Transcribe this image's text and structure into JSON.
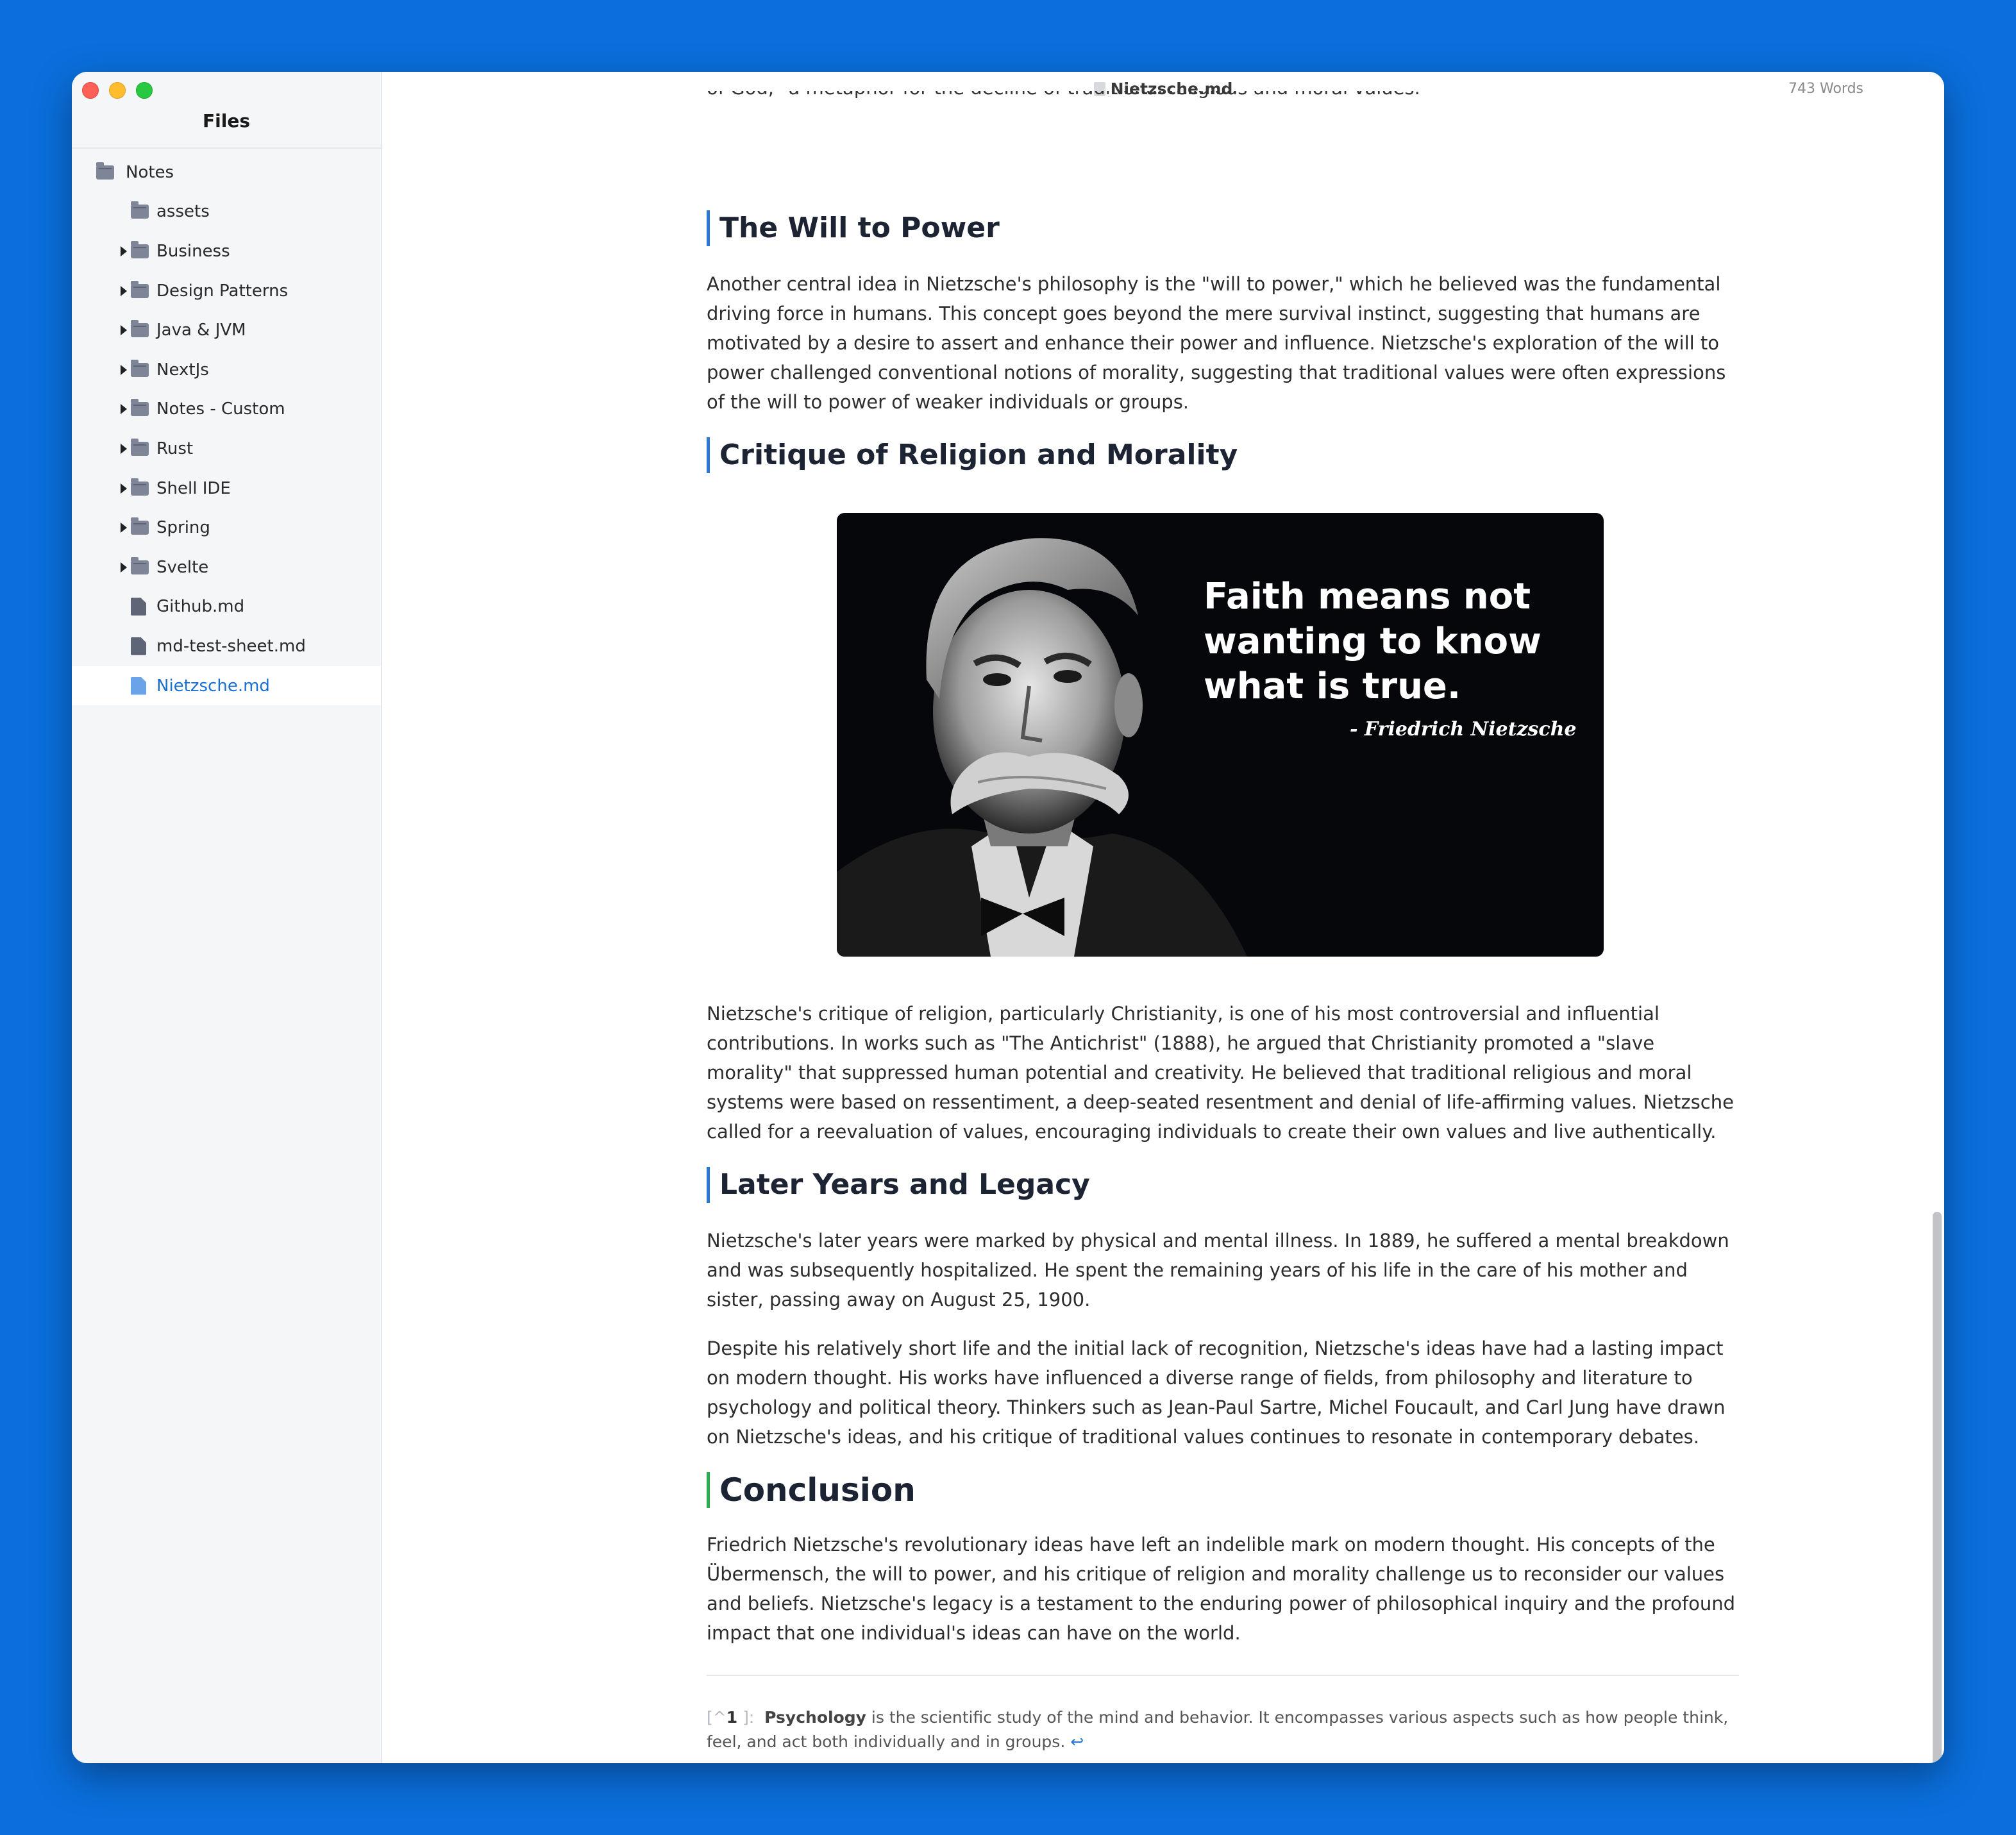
{
  "sidebar": {
    "title": "Files",
    "items": [
      {
        "label": "Notes",
        "type": "folder",
        "expandable": false,
        "depth": 0
      },
      {
        "label": "assets",
        "type": "folder",
        "expandable": false,
        "depth": 1
      },
      {
        "label": "Business",
        "type": "folder",
        "expandable": true,
        "depth": 1
      },
      {
        "label": "Design Patterns",
        "type": "folder",
        "expandable": true,
        "depth": 1
      },
      {
        "label": "Java & JVM",
        "type": "folder",
        "expandable": true,
        "depth": 1
      },
      {
        "label": "NextJs",
        "type": "folder",
        "expandable": true,
        "depth": 1
      },
      {
        "label": "Notes - Custom",
        "type": "folder",
        "expandable": true,
        "depth": 1
      },
      {
        "label": "Rust",
        "type": "folder",
        "expandable": true,
        "depth": 1
      },
      {
        "label": "Shell IDE",
        "type": "folder",
        "expandable": true,
        "depth": 1
      },
      {
        "label": "Spring",
        "type": "folder",
        "expandable": true,
        "depth": 1
      },
      {
        "label": "Svelte",
        "type": "folder",
        "expandable": true,
        "depth": 1
      },
      {
        "label": "Github.md",
        "type": "file",
        "expandable": false,
        "depth": 1
      },
      {
        "label": "md-test-sheet.md",
        "type": "file",
        "expandable": false,
        "depth": 1
      },
      {
        "label": "Nietzsche.md",
        "type": "file",
        "expandable": false,
        "depth": 1,
        "selected": true
      }
    ]
  },
  "titlebar": {
    "filename": "Nietzsche.md",
    "word_count": "743 Words"
  },
  "document": {
    "cut_line": "of God,\" a metaphor for the decline of traditional religious and moral values.",
    "sections": [
      {
        "heading": "The Will to Power",
        "paragraphs": [
          "Another central idea in Nietzsche's philosophy is the \"will to power,\" which he believed was the fundamental driving force in humans. This concept goes beyond the mere survival instinct, suggesting that humans are motivated by a desire to assert and enhance their power and influence. Nietzsche's exploration of the will to power challenged conventional notions of morality, suggesting that traditional values were often expressions of the will to power of weaker individuals or groups."
        ]
      },
      {
        "heading": "Critique of Religion and Morality",
        "image": {
          "quote": "Faith means not wanting to know what is true.",
          "author": "- Friedrich Nietzsche"
        },
        "paragraphs": [
          "Nietzsche's critique of religion, particularly Christianity, is one of his most controversial and influential contributions. In works such as \"The Antichrist\" (1888), he argued that Christianity promoted a \"slave morality\" that suppressed human potential and creativity. He believed that traditional religious and moral systems were based on ressentiment, a deep-seated resentment and denial of life-affirming values. Nietzsche called for a reevaluation of values, encouraging individuals to create their own values and live authentically."
        ]
      },
      {
        "heading": "Later Years and Legacy",
        "paragraphs": [
          "Nietzsche's later years were marked by physical and mental illness. In 1889, he suffered a mental breakdown and was subsequently hospitalized. He spent the remaining years of his life in the care of his mother and sister, passing away on August 25, 1900.",
          "Despite his relatively short life and the initial lack of recognition, Nietzsche's ideas have had a lasting impact on modern thought. His works have influenced a diverse range of fields, from philosophy and literature to psychology and political theory. Thinkers such as Jean-Paul Sartre, Michel Foucault, and Carl Jung have drawn on Nietzsche's ideas, and his critique of traditional values continues to resonate in contemporary debates."
        ]
      },
      {
        "heading": "Conclusion",
        "paragraphs": [
          "Friedrich Nietzsche's revolutionary ideas have left an indelible mark on modern thought. His concepts of the Übermensch, the will to power, and his critique of religion and morality challenge us to reconsider our values and beliefs. Nietzsche's legacy is a testament to the enduring power of philosophical inquiry and the profound impact that one individual's ideas can have on the world."
        ]
      }
    ],
    "footnote": {
      "ref_open": "[^",
      "ref_num": "1",
      "ref_close": "]:",
      "term": "Psychology",
      "text": " is the scientific study of the mind and behavior. It encompasses various aspects such as how people think, feel, and act both individually and in groups.",
      "back_icon": "↩"
    }
  },
  "colors": {
    "desktop": "#0a6fdc",
    "accent": "#2a78d6",
    "conclusion_bar": "#27b04f",
    "selected_text": "#1a6fd0"
  }
}
